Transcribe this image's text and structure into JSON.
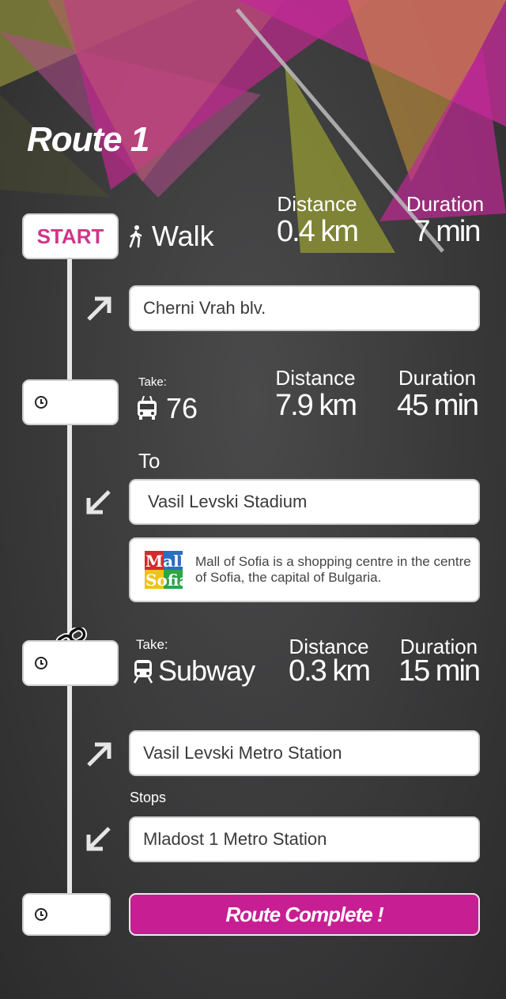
{
  "route": {
    "title": "Route 1"
  },
  "leg1": {
    "start_label": "START",
    "mode": "Walk",
    "distance_header": "Distance",
    "distance": "0.4 km",
    "duration_header": "Duration",
    "duration": "7 min",
    "street": "Cherni Vrah blv."
  },
  "leg2": {
    "take_label": "Take:",
    "line": "76",
    "distance_header": "Distance",
    "distance": "7.9 km",
    "duration_header": "Duration",
    "duration": "45 min",
    "to_label": "To",
    "destination": "Vasil Levski Stadium",
    "info_text": "Mall of Sofia is a shopping centre in the centre of Sofia, the capital of Bulgaria.",
    "logo_top": "Mall",
    "logo_bottom": "Sofia"
  },
  "leg3": {
    "take_label": "Take:",
    "mode": "Subway",
    "distance_header": "Distance",
    "distance": "0.3 km",
    "duration_header": "Duration",
    "duration": "15 min",
    "from_station": "Vasil Levski Metro Station",
    "stops_label": "Stops",
    "to_station": "Mladost 1 Metro Station"
  },
  "footer": {
    "complete_label": "Route Complete !"
  },
  "colors": {
    "accent": "#c71f93",
    "start_text": "#d0358a",
    "background": "#3a3a3b"
  }
}
